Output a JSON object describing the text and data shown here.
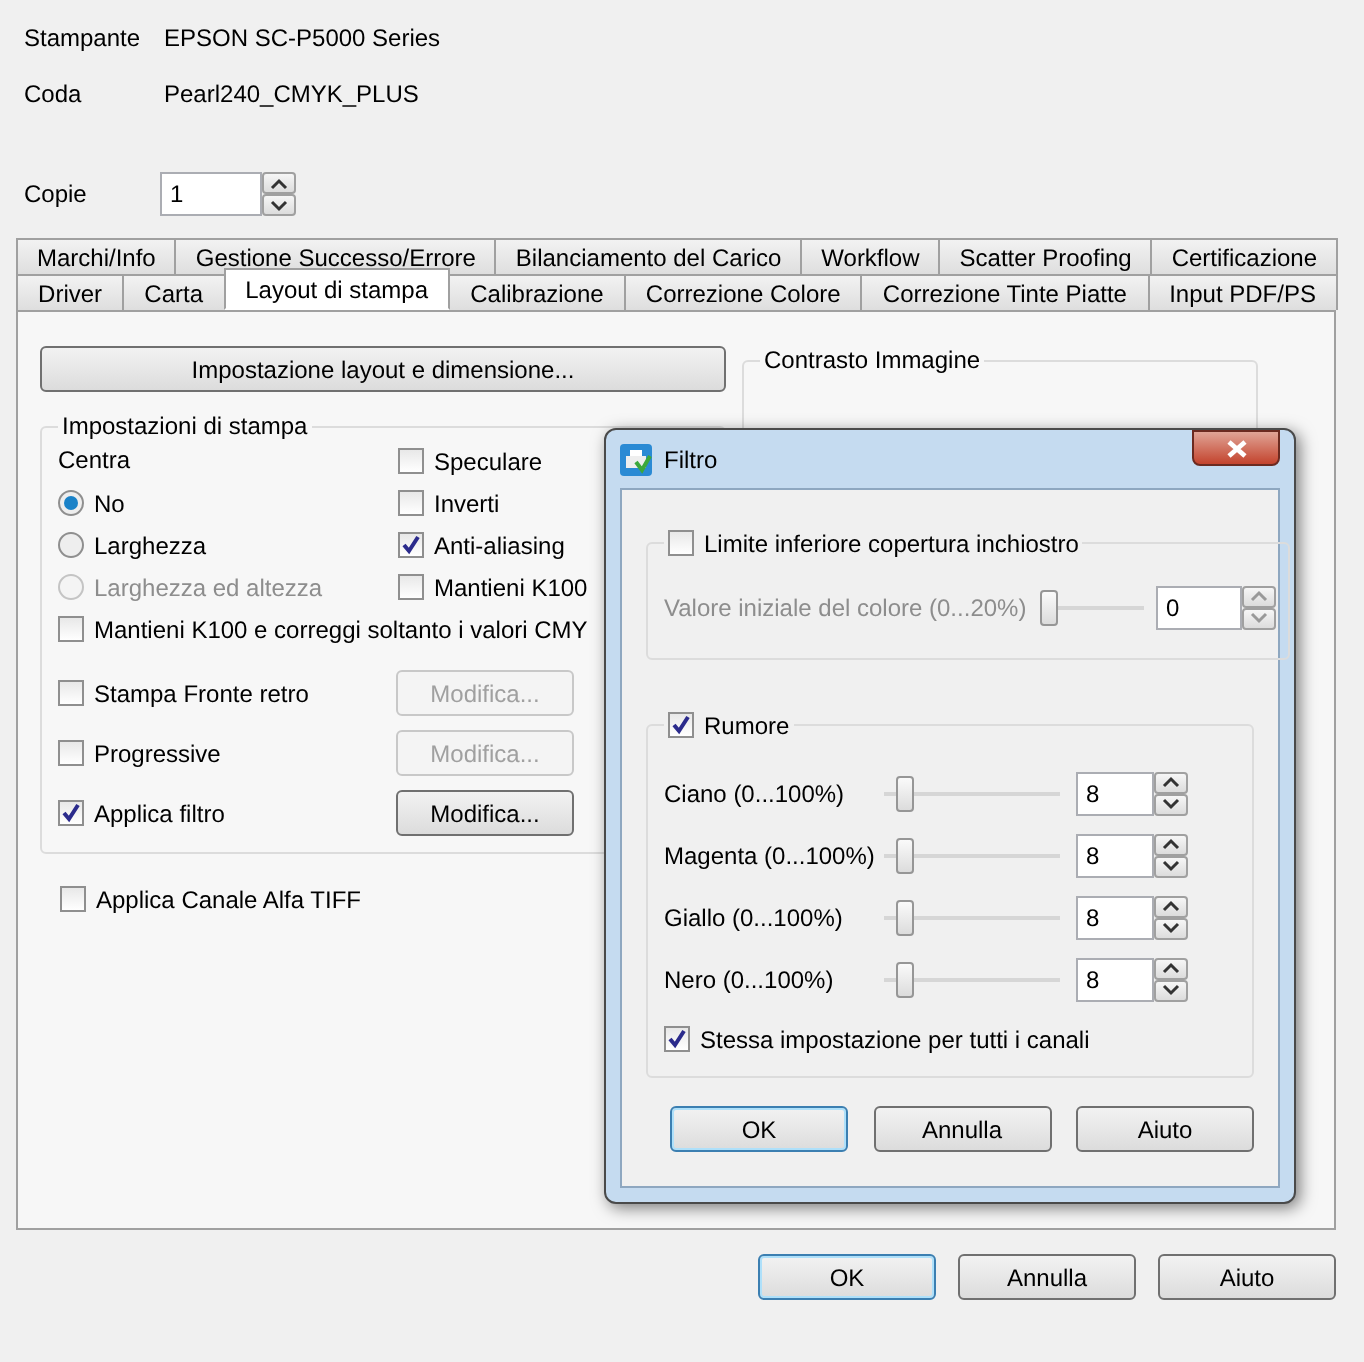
{
  "printer": {
    "label": "Stampante",
    "value": "EPSON SC-P5000 Series"
  },
  "queue": {
    "label": "Coda",
    "value": "Pearl240_CMYK_PLUS"
  },
  "copies": {
    "label": "Copie",
    "value": "1"
  },
  "tab_rows": [
    [
      {
        "label": "Marchi/Info",
        "selected": false
      },
      {
        "label": "Gestione Successo/Errore",
        "selected": false
      },
      {
        "label": "Bilanciamento del Carico",
        "selected": false
      },
      {
        "label": "Workflow",
        "selected": false
      },
      {
        "label": "Scatter Proofing",
        "selected": false
      },
      {
        "label": "Certificazione",
        "selected": false
      }
    ],
    [
      {
        "label": "Driver",
        "selected": false
      },
      {
        "label": "Carta",
        "selected": false
      },
      {
        "label": "Layout di stampa",
        "selected": true
      },
      {
        "label": "Calibrazione",
        "selected": false
      },
      {
        "label": "Correzione Colore",
        "selected": false
      },
      {
        "label": "Correzione Tinte Piatte",
        "selected": false
      },
      {
        "label": "Input PDF/PS",
        "selected": false
      }
    ]
  ],
  "layout_button": "Impostazione layout e dimensione...",
  "print_settings": {
    "title": "Impostazioni di stampa",
    "center_label": "Centra",
    "center_options": [
      {
        "label": "No",
        "selected": true,
        "disabled": false
      },
      {
        "label": "Larghezza",
        "selected": false,
        "disabled": false
      },
      {
        "label": "Larghezza ed altezza",
        "selected": false,
        "disabled": true
      }
    ],
    "options": [
      {
        "label": "Speculare",
        "checked": false
      },
      {
        "label": "Inverti",
        "checked": false
      },
      {
        "label": "Anti-aliasing",
        "checked": true
      },
      {
        "label": "Mantieni K100",
        "checked": false
      }
    ],
    "k100_cmy": {
      "label": "Mantieni K100 e correggi soltanto i valori CMY",
      "checked": false
    },
    "edit_rows": [
      {
        "label": "Stampa Fronte retro",
        "checked": false,
        "button": "Modifica...",
        "disabled": true
      },
      {
        "label": "Progressive",
        "checked": false,
        "button": "Modifica...",
        "disabled": true
      },
      {
        "label": "Applica filtro",
        "checked": true,
        "button": "Modifica...",
        "disabled": false
      }
    ]
  },
  "alpha_tiff": {
    "label": "Applica Canale Alfa TIFF",
    "checked": false
  },
  "image_contrast": {
    "title": "Contrasto Immagine"
  },
  "dialog": {
    "title": "Filtro",
    "ink_limit": {
      "label": "Limite inferiore copertura inchiostro",
      "checked": false,
      "field_label": "Valore iniziale del colore (0...20%)",
      "level": 0,
      "value": "0",
      "disabled": true
    },
    "noise": {
      "label": "Rumore",
      "checked": true,
      "channels": [
        {
          "name": "Ciano (0...100%)",
          "level": 0.08,
          "value": "8"
        },
        {
          "name": "Magenta (0...100%)",
          "level": 0.08,
          "value": "8"
        },
        {
          "name": "Giallo (0...100%)",
          "level": 0.08,
          "value": "8"
        },
        {
          "name": "Nero (0...100%)",
          "level": 0.08,
          "value": "8"
        }
      ],
      "same_for_all": {
        "label": "Stessa impostazione per tutti i canali",
        "checked": true
      }
    },
    "buttons": [
      {
        "label": "OK",
        "default": true
      },
      {
        "label": "Annulla",
        "default": false
      },
      {
        "label": "Aiuto",
        "default": false
      }
    ]
  },
  "buttons": [
    {
      "label": "OK",
      "default": true
    },
    {
      "label": "Annulla",
      "default": false
    },
    {
      "label": "Aiuto",
      "default": false
    }
  ]
}
